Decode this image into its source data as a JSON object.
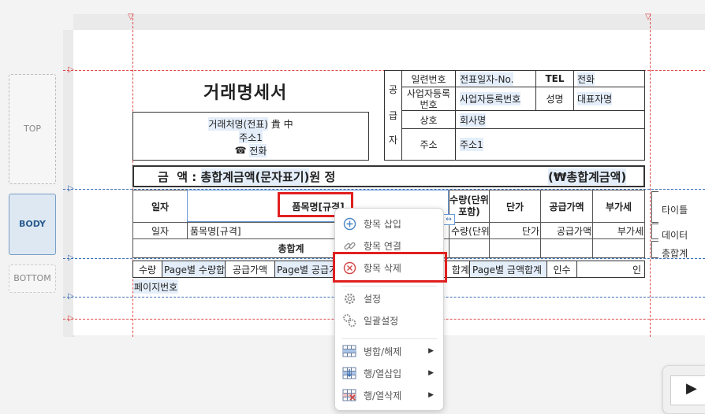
{
  "bands": {
    "top": "TOP",
    "body": "BODY",
    "bottom": "BOTTOM"
  },
  "doc_title": "거래명세서",
  "customer": {
    "name": "거래처명(전표)",
    "honorific": "貴 中",
    "address": "주소1",
    "phone_icon": "☎",
    "phone": "전화"
  },
  "supplier": {
    "header": [
      "공",
      "급",
      "자"
    ],
    "serial_label": "일련번호",
    "serial_value": "전표일자-No.",
    "tel_label": "TEL",
    "tel_value": "전화",
    "bizno_label": "사업자등록 번호",
    "bizno_value": "사업자등록번호",
    "name_label": "성명",
    "name_value": "대표자명",
    "company_label": "상호",
    "company_value": "회사명",
    "addr_label": "주소",
    "addr_value": "주소1"
  },
  "amount": {
    "label": "금  액 : ",
    "value": "총합계금액(문자표기)",
    "suffix": "원 정",
    "right": "(₩총합계금액)"
  },
  "table": {
    "headers": [
      "일자",
      "품목명[규격]",
      "수량(단위포함)",
      "단가",
      "공급가액",
      "부가세"
    ],
    "data": [
      "일자",
      "품목명[규격]",
      "수량(단위",
      "단가",
      "공급가액",
      "부가세"
    ],
    "total": "총합계"
  },
  "right_labels": {
    "title": "타이틀",
    "data": "데이터",
    "total": "총합계"
  },
  "footer": {
    "qty": "수량",
    "page_qty": "Page별 수량합",
    "supply": "공급가액",
    "page_supply": "Page별 공급가",
    "sum": "합계",
    "page_sum": "Page별 금액합계",
    "receiver": "인수",
    "seal": "인"
  },
  "page_no": "페이지번호",
  "context_menu": [
    {
      "label": "항목 삽입",
      "icon": "add-circle-icon"
    },
    {
      "label": "항목 연결",
      "icon": "link-icon"
    },
    {
      "label": "항목 삭제",
      "icon": "delete-circle-icon"
    },
    {
      "label": "설정",
      "icon": "gear-icon"
    },
    {
      "label": "일괄설정",
      "icon": "gears-icon"
    },
    {
      "label": "병합/해제",
      "icon": "merge-grid-icon",
      "submenu": true
    },
    {
      "label": "행/열삽입",
      "icon": "insert-grid-icon",
      "submenu": true
    },
    {
      "label": "행/열삭제",
      "icon": "delete-grid-icon",
      "submenu": true
    }
  ],
  "colors": {
    "highlight": "#e02020",
    "field": "#e4eefa",
    "guide_red": "#e0474a",
    "guide_blue": "#3b6fb6"
  }
}
